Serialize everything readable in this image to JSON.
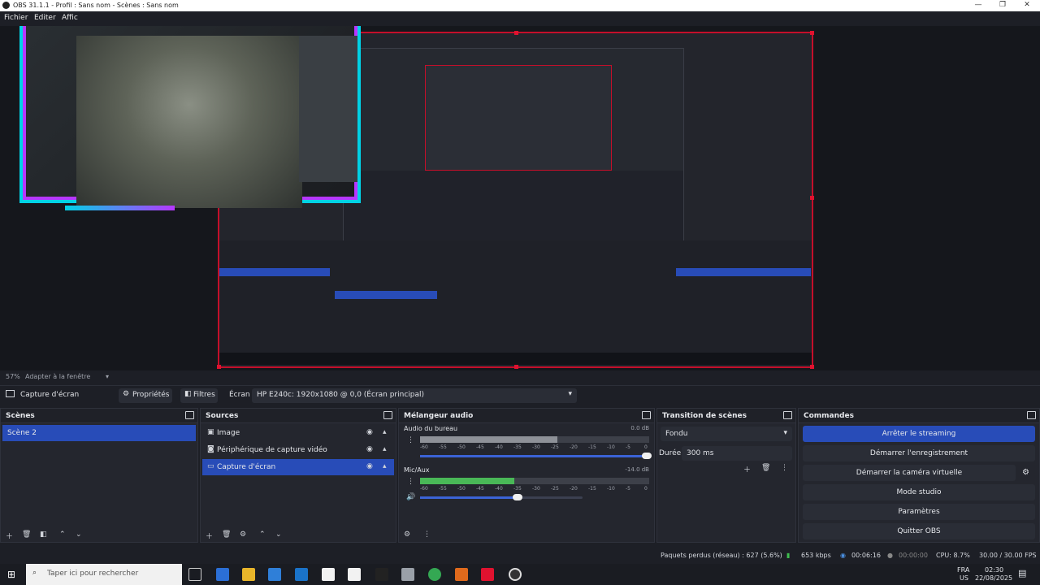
{
  "window": {
    "title": "OBS 31.1.1 - Profil : Sans nom - Scènes : Sans nom",
    "minimize": "—",
    "maximize": "❐",
    "close": "✕"
  },
  "menu": {
    "file": "Fichier",
    "edit": "Editer",
    "view": "Affic"
  },
  "preview": {
    "zoom": "57%",
    "fit": "Adapter à la fenêtre"
  },
  "source_toolbar": {
    "selected": "Capture d'écran",
    "properties": "Propriétés",
    "filters": "Filtres",
    "screen_label": "Écran",
    "screen_value": "HP E240c: 1920x1080 @ 0,0 (Écran principal)"
  },
  "scenes": {
    "title": "Scènes",
    "items": [
      "Scène 2"
    ]
  },
  "sources": {
    "title": "Sources",
    "items": [
      {
        "label": "Image",
        "icon": "image-icon"
      },
      {
        "label": "Périphérique de capture vidéo",
        "icon": "camera-icon"
      },
      {
        "label": "Capture d'écran",
        "icon": "monitor-icon"
      }
    ]
  },
  "mixer": {
    "title": "Mélangeur audio",
    "channels": [
      {
        "name": "Audio du bureau",
        "db": "0.0 dB",
        "level": 0.6,
        "volume": 0.99
      },
      {
        "name": "Mic/Aux",
        "db": "-14.0 dB",
        "level": 0.41,
        "volume": 0.6
      }
    ],
    "ticks": [
      "-60",
      "-55",
      "-50",
      "-45",
      "-40",
      "-35",
      "-30",
      "-25",
      "-20",
      "-15",
      "-10",
      "-5",
      "0"
    ]
  },
  "transition": {
    "title": "Transition de scènes",
    "type": "Fondu",
    "duration_label": "Durée",
    "duration": "300 ms"
  },
  "controls": {
    "title": "Commandes",
    "stream": "Arrêter le streaming",
    "record": "Démarrer l'enregistrement",
    "virtualcam": "Démarrer la caméra virtuelle",
    "studio": "Mode studio",
    "settings": "Paramètres",
    "quit": "Quitter OBS"
  },
  "status": {
    "dropped": "Paquets perdus (réseau) : 627 (5.6%)",
    "bitrate": "653 kbps",
    "stream_time": "00:06:16",
    "rec_time": "00:00:00",
    "cpu": "CPU: 8.7%",
    "fps": "30.00 / 30.00 FPS"
  },
  "taskbar": {
    "search_placeholder": "Taper ici pour rechercher",
    "lang1": "FRA",
    "lang2": "US",
    "time": "02:30",
    "date": "22/08/2025"
  },
  "colors": {
    "accent": "#284cb8",
    "selection_red": "#c40f2a",
    "cyan": "#00d2e6",
    "purple": "#b637ff"
  }
}
